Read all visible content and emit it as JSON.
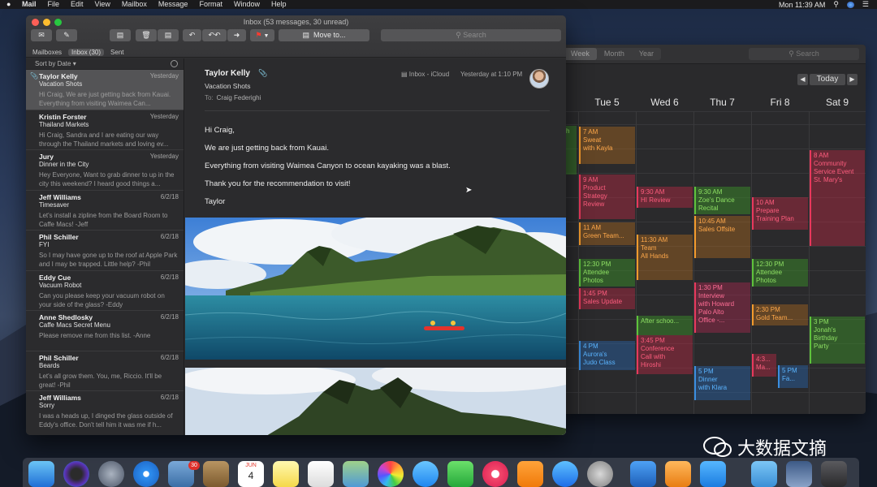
{
  "menubar": {
    "app": "Mail",
    "items": [
      "File",
      "Edit",
      "View",
      "Mailbox",
      "Message",
      "Format",
      "Window",
      "Help"
    ],
    "clock": "Mon 11:39 AM"
  },
  "mail": {
    "window_title": "Inbox (53 messages, 30 unread)",
    "toolbar": {
      "move_to": "Move to...",
      "search_placeholder": "Search"
    },
    "favorites": {
      "mailboxes": "Mailboxes",
      "inbox": "Inbox (30)",
      "sent": "Sent"
    },
    "sort_label": "Sort by Date",
    "messages": [
      {
        "from": "Taylor Kelly",
        "date": "Yesterday",
        "subject": "Vacation Shots",
        "preview": "Hi Craig, We are just getting back from Kauai. Everything from visiting Waimea Can...",
        "attachment": true
      },
      {
        "from": "Kristin Forster",
        "date": "Yesterday",
        "subject": "Thailand Markets",
        "preview": "Hi Craig, Sandra and I are eating our way through the Thailand markets and loving ev..."
      },
      {
        "from": "Jury",
        "date": "Yesterday",
        "subject": "Dinner in the City",
        "preview": "Hey Everyone, Want to grab dinner to up in the city this weekend? I heard good things a..."
      },
      {
        "from": "Jeff Williams",
        "date": "6/2/18",
        "subject": "Timesaver",
        "preview": "Let's install a zipline from the Board Room to Caffe Macs! -Jeff"
      },
      {
        "from": "Phil Schiller",
        "date": "6/2/18",
        "subject": "FYI",
        "preview": "So I may have gone up to the roof at Apple Park and I may be trapped. Little help? -Phil"
      },
      {
        "from": "Eddy Cue",
        "date": "6/2/18",
        "subject": "Vacuum Robot",
        "preview": "Can you please keep your vacuum robot on your side of the glass? -Eddy"
      },
      {
        "from": "Anne Shedlosky",
        "date": "6/2/18",
        "subject": "Caffe Macs Secret Menu",
        "preview": "Please remove me from this list. -Anne"
      },
      {
        "from": "Phil Schiller",
        "date": "6/2/18",
        "subject": "Beards",
        "preview": "Let's all grow them. You, me, Riccio. It'll be great! -Phil"
      },
      {
        "from": "Jeff Williams",
        "date": "6/2/18",
        "subject": "Sorry",
        "preview": "I was a heads up, I dinged the glass outside of Eddy's office. Don't tell him it was me if h..."
      }
    ],
    "reader": {
      "from": "Taylor Kelly",
      "subject": "Vacation Shots",
      "to_label": "To:",
      "to": "Craig Federighi",
      "mailbox": "Inbox - iCloud",
      "date": "Yesterday at 1:10 PM",
      "body": [
        "Hi Craig,",
        "We are just getting back from Kauai.",
        "Everything from visiting Waimea Canyon to ocean kayaking was a blast.",
        "Thank you for the recommendation to visit!",
        "Taylor"
      ]
    }
  },
  "calendar": {
    "views": [
      "Week",
      "Month",
      "Year"
    ],
    "search_placeholder": "Search",
    "today": "Today",
    "days": [
      "Tue 5",
      "Wed 6",
      "Thu 7",
      "Fri 8",
      "Sat 9"
    ],
    "events": [
      {
        "color": "green",
        "text": "h"
      },
      {
        "color": "orange",
        "text": "7 AM\nSweat\nwith Kayla"
      },
      {
        "color": "red",
        "text": "9 AM\nProduct\nStrategy\nReview"
      },
      {
        "color": "orange",
        "text": "11 AM\nGreen Team..."
      },
      {
        "color": "green",
        "text": "12:30 PM\nAttendee\nPhotos"
      },
      {
        "color": "red",
        "text": "1:45 PM\nSales Update"
      },
      {
        "color": "blue",
        "text": "4 PM\nAurora's\nJudo Class"
      },
      {
        "color": "red",
        "text": "9:30 AM\nHI Review"
      },
      {
        "color": "orange",
        "text": "11:30 AM\nTeam\nAll Hands"
      },
      {
        "color": "green",
        "text": "After schoo..."
      },
      {
        "color": "red",
        "text": "3:45 PM\nConference\nCall with\nHiroshi"
      },
      {
        "color": "green",
        "text": "9:30 AM\nZoe's Dance\nRecital"
      },
      {
        "color": "orange",
        "text": "10:45 AM\nSales Offsite"
      },
      {
        "color": "pink",
        "text": "1:30 PM\nInterview\nwith Howard\nPalo Alto\nOffice -..."
      },
      {
        "color": "blue",
        "text": "5 PM\nDinner\nwith Klara"
      },
      {
        "color": "red",
        "text": "10 AM\nPrepare\nTraining Plan"
      },
      {
        "color": "green",
        "text": "12:30 PM\nAttendee\nPhotos"
      },
      {
        "color": "orange",
        "text": "2:30 PM\nGold Team..."
      },
      {
        "color": "red",
        "text": "4:3...\nMa..."
      },
      {
        "color": "blue",
        "text": "5 PM\nFa..."
      },
      {
        "color": "red",
        "text": "8 AM\nCommunity\nService Event\nSt. Mary's"
      },
      {
        "color": "green",
        "text": "3 PM\nJonah's\nBirthday\nParty"
      }
    ]
  },
  "dock": {
    "photos_badge": "30",
    "calendar_month": "JUN",
    "calendar_day": "4"
  },
  "watermark": "大数据文摘"
}
